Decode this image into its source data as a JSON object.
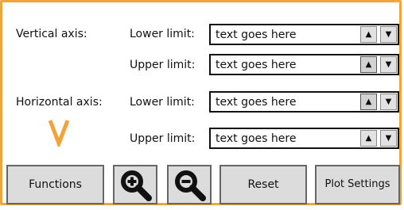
{
  "axes": {
    "vertical_label": "Vertical axis:",
    "horizontal_label": "Horizontal axis:",
    "lower_label": "Lower limit:",
    "upper_label": "Upper limit:",
    "field_value": "text goes here"
  },
  "spinner": {
    "up_glyph": "▲",
    "down_glyph": "▼"
  },
  "buttons": {
    "functions": "Functions",
    "reset": "Reset",
    "plot_settings": "Plot Settings"
  },
  "colors": {
    "panel_border": "#f2a33a",
    "cursor_marker": "#f2a33a",
    "button_fill": "#dcdcdc"
  },
  "icons": [
    "zoom-in-icon",
    "zoom-out-icon",
    "cursor-marker-icon"
  ]
}
